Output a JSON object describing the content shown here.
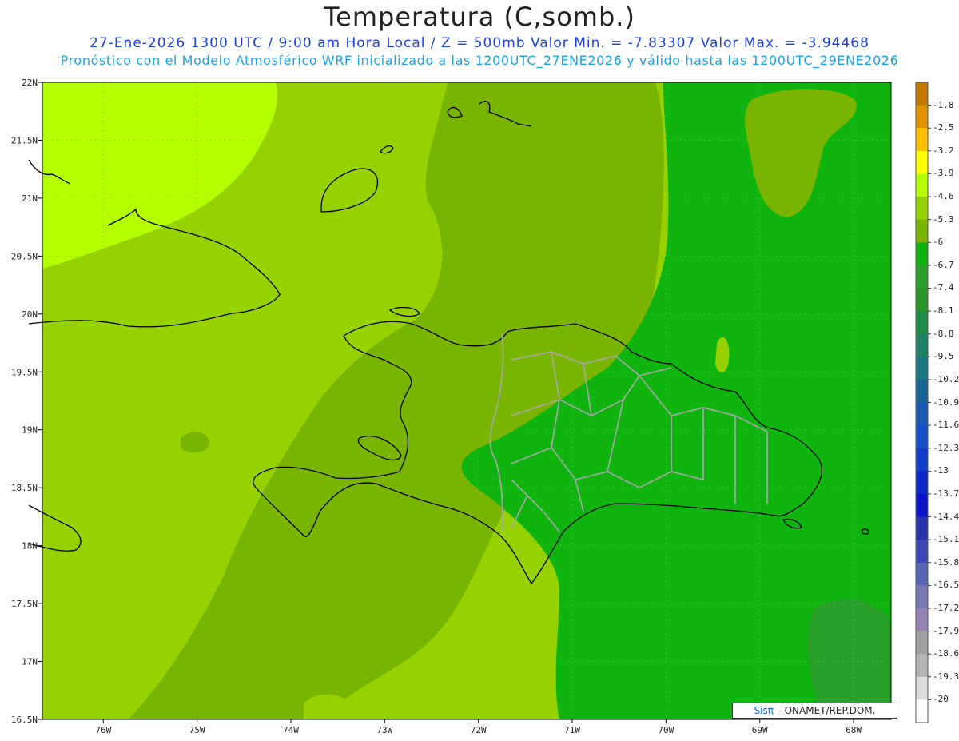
{
  "header": {
    "title": "Temperatura (C,somb.)",
    "line1": "27-Ene-2026  1300 UTC / 9:00 am Hora Local / Z = 500mb  Valor Min. = -7.83307  Valor Max. = -3.94468",
    "line2": "Pronóstico con el Modelo Atmosférico WRF inicializado a las 1200UTC_27ENE2026 y válido hasta las  1200UTC_29ENE2026"
  },
  "map": {
    "lat_ticks": [
      "22N",
      "21.5N",
      "21N",
      "20.5N",
      "20N",
      "19.5N",
      "19N",
      "18.5N",
      "18N",
      "17.5N",
      "17N",
      "16.5N"
    ],
    "lon_ticks": [
      "76W",
      "75W",
      "74W",
      "73W",
      "72W",
      "71W",
      "70W",
      "69W",
      "68W"
    ],
    "lat_range": [
      16.5,
      22.0
    ],
    "lon_range": [
      -76.65,
      -67.6
    ],
    "gridlines": true
  },
  "colorbar": {
    "labels": [
      "-1.8",
      "-2.5",
      "-3.2",
      "-3.9",
      "-4.6",
      "-5.3",
      "-6",
      "-6.7",
      "-7.4",
      "-8.1",
      "-8.8",
      "-9.5",
      "-10.2",
      "-10.9",
      "-11.6",
      "-12.3",
      "-13",
      "-13.7",
      "-14.4",
      "-15.1",
      "-15.8",
      "-16.5",
      "-17.2",
      "-17.9",
      "-18.6",
      "-19.3",
      "-20"
    ],
    "colors": [
      "#c47a00",
      "#e09400",
      "#ffbf00",
      "#ffff00",
      "#b4ff00",
      "#96d200",
      "#78b400",
      "#0fb40f",
      "#2aa02a",
      "#2a962a",
      "#1e8c46",
      "#1e8264",
      "#197882",
      "#196496",
      "#195ab4",
      "#1450c8",
      "#0f3cc8",
      "#0a28c8",
      "#0a14c8",
      "#2832aa",
      "#3c46b4",
      "#5a64b4",
      "#7878b4",
      "#9682b4",
      "#a0a0a0",
      "#b4b4b4",
      "#dcdcdc",
      "#ffffff"
    ]
  },
  "field_colors": {
    "warmest": "#b4ff00",
    "warm": "#96d200",
    "mid": "#78b400",
    "cool": "#0fb40f",
    "coolest": "#2aa02a"
  },
  "credit": {
    "brand": "Sisπ",
    "text": "– ONAMET/REP.DOM."
  }
}
